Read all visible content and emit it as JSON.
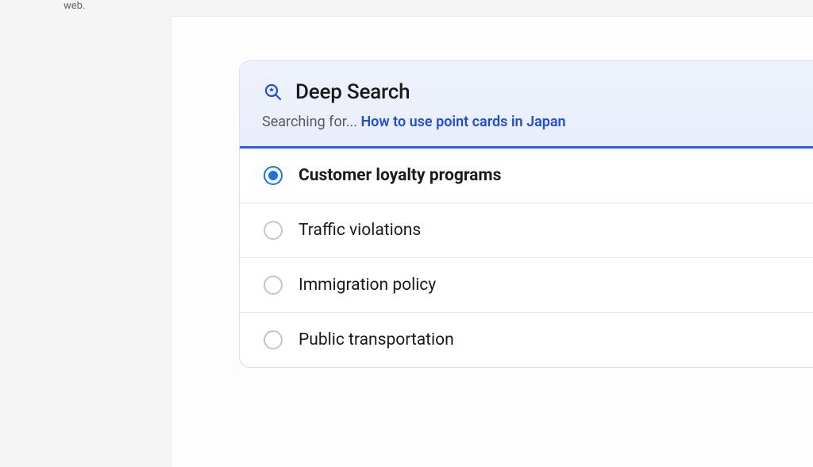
{
  "page": {
    "top_text": "web."
  },
  "deep_search": {
    "title": "Deep Search",
    "searching_prefix": "Searching for... ",
    "query": "How to use point cards in Japan",
    "options": [
      {
        "label": "Customer loyalty programs",
        "selected": true
      },
      {
        "label": "Traffic violations",
        "selected": false
      },
      {
        "label": "Immigration policy",
        "selected": false
      },
      {
        "label": "Public transportation",
        "selected": false
      }
    ]
  }
}
